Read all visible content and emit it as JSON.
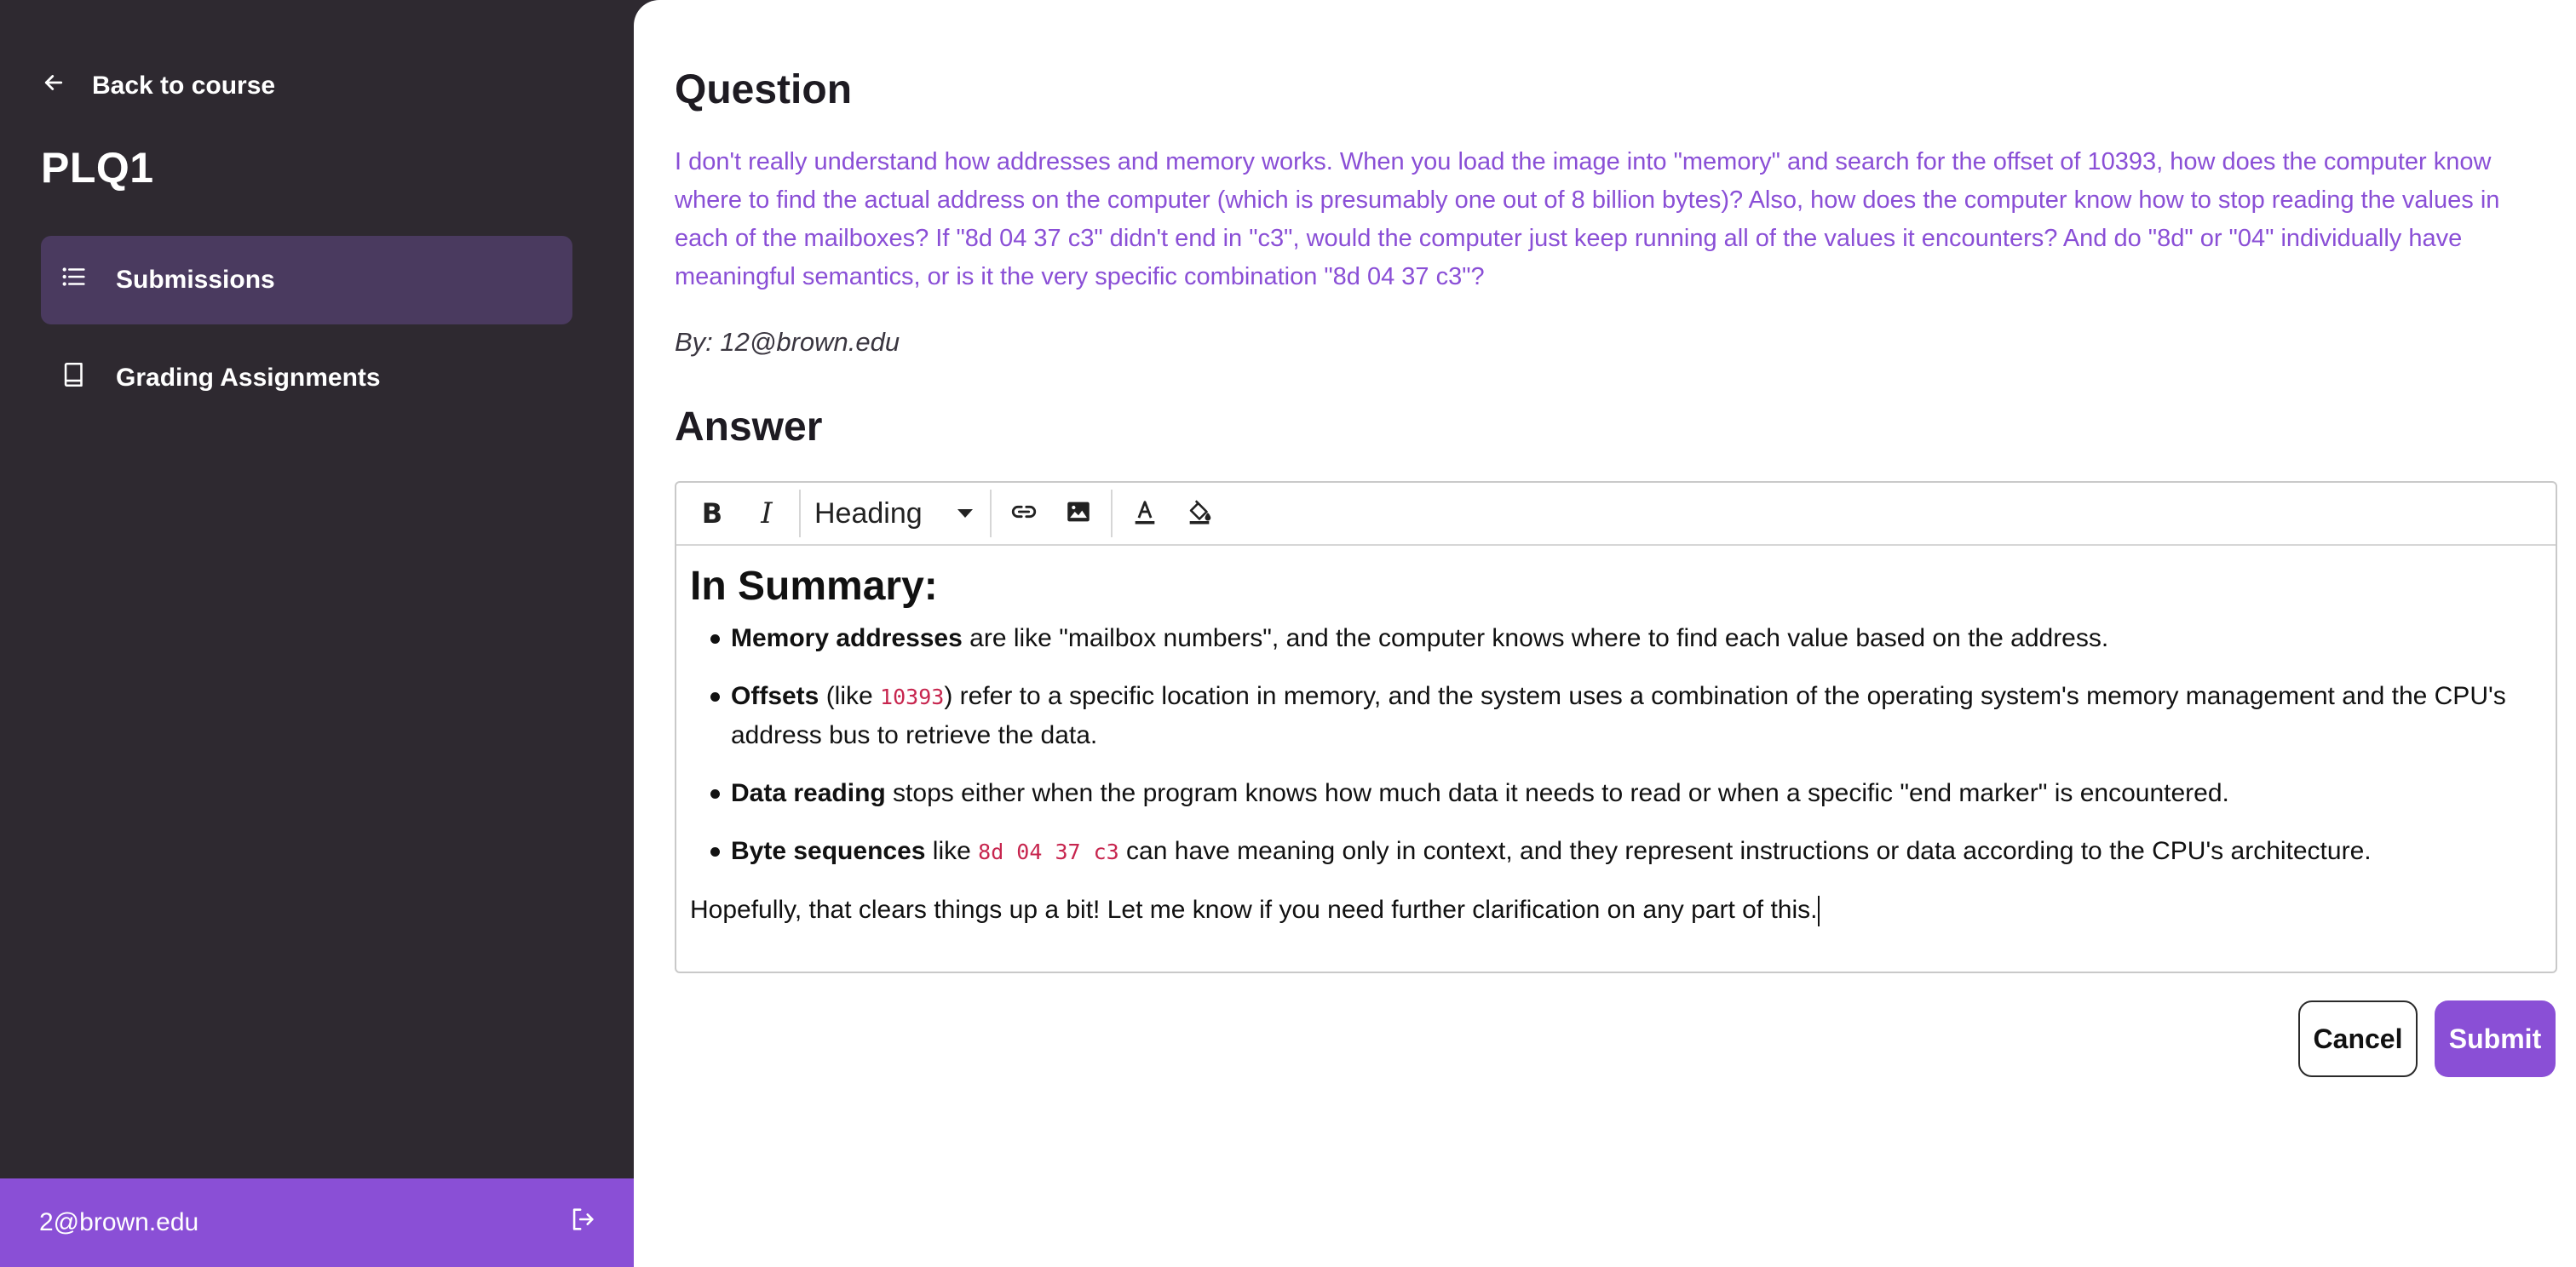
{
  "sidebar": {
    "back_label": "Back to course",
    "course_title": "PLQ1",
    "nav": [
      {
        "label": "Submissions",
        "icon": "list-icon",
        "active": true
      },
      {
        "label": "Grading Assignments",
        "icon": "book-icon",
        "active": false
      }
    ],
    "user_email": "2@brown.edu"
  },
  "question": {
    "heading": "Question",
    "text": "I don't really understand how addresses and memory works. When you load the image into \"memory\" and search for the offset of 10393, how does the computer know where to find the actual address on the computer (which is presumably one out of 8 billion bytes)? Also, how does the computer know how to stop reading the values in each of the mailboxes? If \"8d 04 37 c3\" didn't end in \"c3\", would the computer just keep running all of the values it encounters? And do \"8d\" or \"04\" individually have meaningful semantics, or is it the very specific combination \"8d 04 37 c3\"?",
    "author": "By: 12@brown.edu"
  },
  "answer": {
    "heading": "Answer",
    "toolbar": {
      "bold": "B",
      "italic": "I",
      "block_format": "Heading"
    },
    "content": {
      "title": "In Summary:",
      "items": [
        {
          "strong": "Memory addresses",
          "text": " are like \"mailbox numbers\", and the computer knows where to find each value based on the address."
        },
        {
          "strong": "Offsets",
          "pre": " (like ",
          "code": "10393",
          "text": ") refer to a specific location in memory, and the system uses a combination of the operating system's memory management and the CPU's address bus to retrieve the data."
        },
        {
          "strong": "Data reading",
          "text": " stops either when the program knows how much data it needs to read or when a specific \"end marker\" is encountered."
        },
        {
          "strong": "Byte sequences",
          "pre": " like ",
          "code": "8d 04 37 c3",
          "text": " can have meaning only in context, and they represent instructions or data according to the CPU's architecture."
        }
      ],
      "closing": "Hopefully, that clears things up a bit! Let me know if you need further clarification on any part of this."
    },
    "cancel_label": "Cancel",
    "submit_label": "Submit"
  },
  "colors": {
    "accent": "#8a4fd6",
    "sidebar_bg": "#2e2930",
    "active_nav_bg": "#4a3a5f",
    "code": "#c7254e"
  }
}
